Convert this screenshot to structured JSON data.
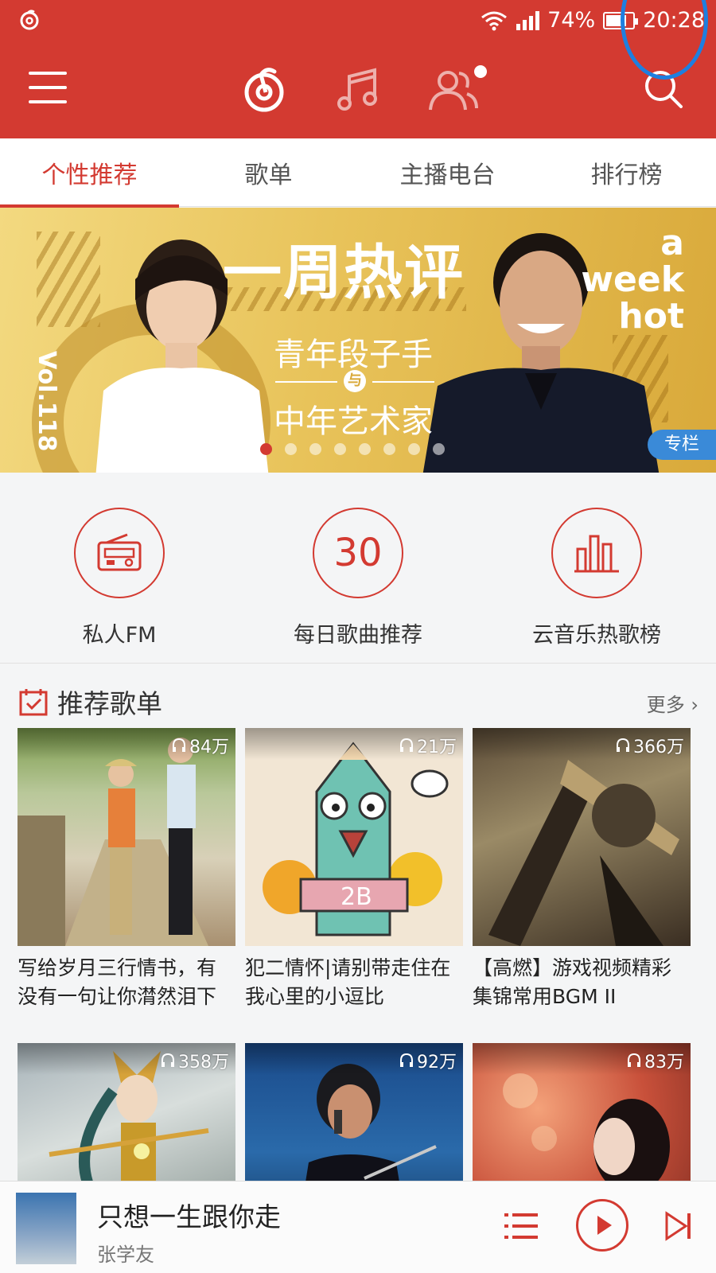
{
  "status_bar": {
    "battery": "74%",
    "time": "20:28"
  },
  "navbar": {
    "icons": [
      "menu-icon",
      "netease-logo-icon",
      "music-note-icon",
      "friends-icon",
      "search-icon"
    ],
    "annotation_color": "#1e7fe0"
  },
  "tabs": [
    {
      "label": "个性推荐",
      "active": true
    },
    {
      "label": "歌单",
      "active": false
    },
    {
      "label": "主播电台",
      "active": false
    },
    {
      "label": "排行榜",
      "active": false
    }
  ],
  "banner": {
    "title": "一周热评",
    "en_line1": "a",
    "en_line2": "week",
    "en_line3": "hot",
    "subtitle_top": "青年段子手",
    "connector": "与",
    "subtitle_bottom": "中年艺术家",
    "volume": "Vol.118",
    "tag": "专栏",
    "dots_total": 8,
    "dots_active_index": 0
  },
  "quick_entries": [
    {
      "label": "私人FM",
      "icon": "radio-icon"
    },
    {
      "label": "每日歌曲推荐",
      "number": "30",
      "icon": "calendar-number-icon"
    },
    {
      "label": "云音乐热歌榜",
      "icon": "bar-chart-icon"
    }
  ],
  "recommend": {
    "title": "推荐歌单",
    "more": "更多"
  },
  "playlists": [
    {
      "title": "写给岁月三行情书，有没有一句让你潸然泪下",
      "plays": "84万"
    },
    {
      "title": "犯二情怀|请别带走住在我心里的小逗比",
      "plays": "21万"
    },
    {
      "title": "【高燃】游戏视频精彩集锦常用BGM II",
      "plays": "366万"
    },
    {
      "title": "",
      "plays": "358万"
    },
    {
      "title": "",
      "plays": "92万"
    },
    {
      "title": "",
      "plays": "83万"
    }
  ],
  "player": {
    "song": "只想一生跟你走",
    "artist": "张学友"
  },
  "colors": {
    "brand_red": "#d33a31",
    "tag_blue": "#3a8ad8"
  }
}
